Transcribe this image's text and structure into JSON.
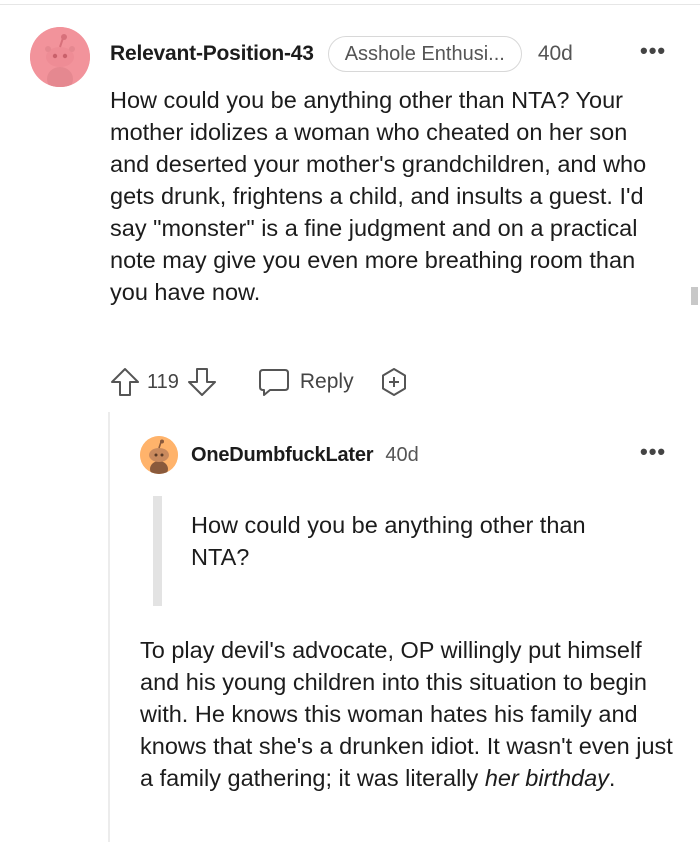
{
  "comment": {
    "author": "Relevant-Position-43",
    "flair": "Asshole Enthusi...",
    "age": "40d",
    "more": "•••",
    "body": "How could you be anything other than NTA? Your mother idolizes a woman who cheated on her son and deserted your mother's grandchildren, and who gets drunk, frightens a child, and insults a guest. I'd say \"monster\" is a fine judgment and on a practical note may give you even more breathing room than you have now.",
    "upvotes": "119",
    "reply_label": "Reply",
    "avatar_color": "#f2939b"
  },
  "reply": {
    "author": "OneDumbfuckLater",
    "age": "40d",
    "more": "•••",
    "quote": "How could you be anything other than NTA?",
    "body_main": "To play devil's advocate, OP willingly put himself and his young children into this situation to begin with. He knows this woman hates his family and knows that she's a drunken idiot. It wasn't even just a family gathering; it was literally ",
    "body_emphasis": "her birthday",
    "body_end": ".",
    "avatar_color": "#ffb36b"
  }
}
